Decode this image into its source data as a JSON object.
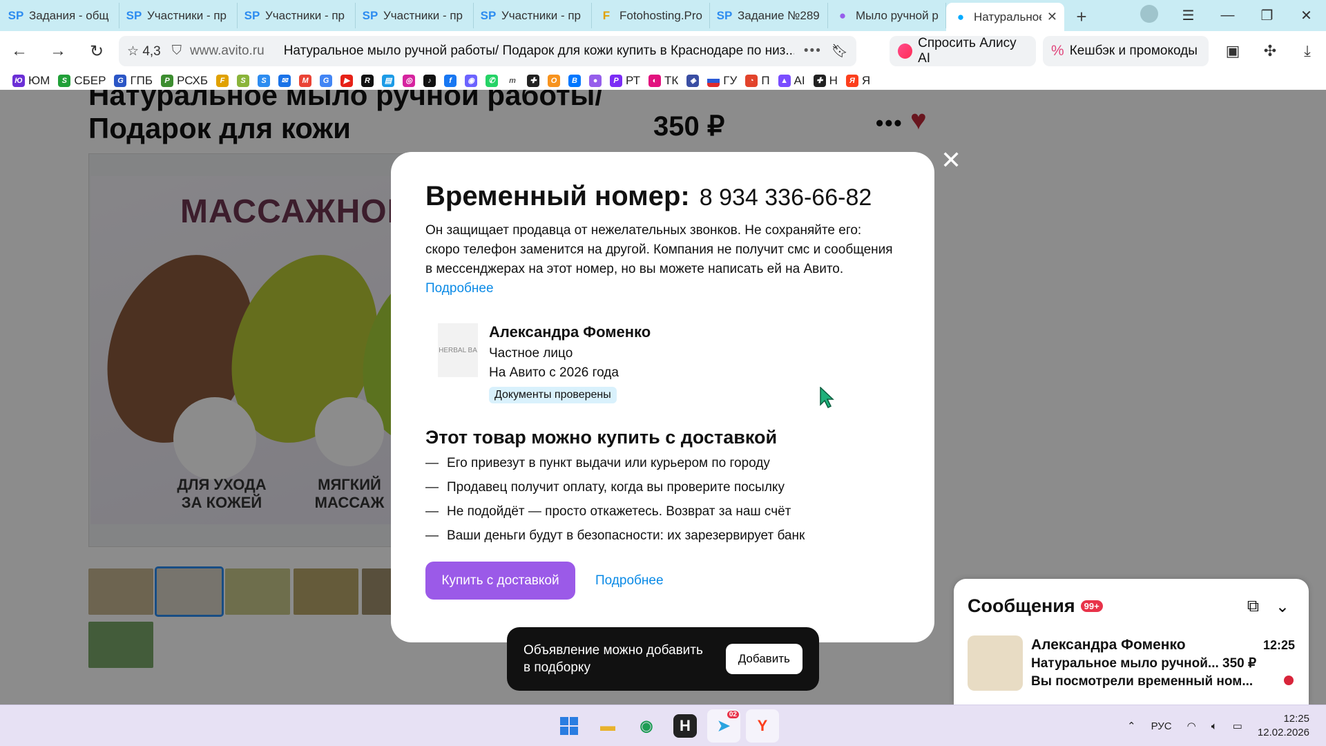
{
  "browser": {
    "tabs": [
      {
        "fav": "SP",
        "title": "Задания - общ"
      },
      {
        "fav": "SP",
        "title": "Участники - пр"
      },
      {
        "fav": "SP",
        "title": "Участники - пр"
      },
      {
        "fav": "SP",
        "title": "Участники - пр"
      },
      {
        "fav": "SP",
        "title": "Участники - пр"
      },
      {
        "fav": "F",
        "title": "Fotohosting.Pro"
      },
      {
        "fav": "SP",
        "title": "Задание №289"
      },
      {
        "fav": "●",
        "title": "Мыло ручной р"
      },
      {
        "fav": "●",
        "title": "Натуральное"
      }
    ],
    "rating": "4,3",
    "domain": "www.avito.ru",
    "page_title": "Натуральное мыло ручной работы/ Подарок для кожи купить в Краснодаре по низ...",
    "alice_label": "Спросить Алису AI",
    "cashback_label": "Кешбэк и промокоды",
    "bookmarks": [
      "ЮМ",
      "СБЕР",
      "ГПБ",
      "РСХБ",
      "",
      "",
      "",
      "",
      "",
      "",
      "",
      "",
      "",
      "",
      "",
      "",
      "",
      "",
      "",
      "",
      "",
      "",
      "",
      "",
      "",
      "РТ",
      "ТК",
      "",
      "ГУ",
      "П",
      "AI",
      "Н",
      "Я"
    ]
  },
  "listing": {
    "title_line2": "Подарок для кожи",
    "title_line1": "Натуральное мыло ручной работы/",
    "price": "350 ₽",
    "photo_text": "МАССАЖНОЕ",
    "caption1": "ДЛЯ УХОДА\nЗА КОЖЕЙ",
    "caption2": "МЯГКИЙ\nМАССАЖ"
  },
  "modal": {
    "heading": "Временный номер:",
    "phone": "8 934 336-66-82",
    "desc": "Он защищает продавца от нежелательных звонков. Не сохраняйте его: скоро телефон заменится на другой. Компания не получит смс и сообщения в мессенджерах на этот номер, но вы можете написать ей на Авито.",
    "desc_link": "Подробнее",
    "seller_name": "Александра Фоменко",
    "seller_type": "Частное лицо",
    "seller_since": "На Авито с 2026 года",
    "seller_badge": "Документы проверены",
    "seller_logo_text": "HERBAL BA",
    "delivery_heading": "Этот товар можно купить с доставкой",
    "delivery_points": [
      "Его привезут в пункт выдачи или курьером по городу",
      "Продавец получит оплату, когда вы проверите посылку",
      "Не подойдёт — просто откажетесь. Возврат за наш счёт",
      "Ваши деньги будут в безопасности: их зарезервирует банк"
    ],
    "buy_button": "Купить с доставкой",
    "more_link": "Подробнее"
  },
  "toast": {
    "text": "Объявление можно добавить в подборку",
    "button": "Добавить"
  },
  "messages": {
    "title": "Сообщения",
    "count": "99+",
    "item": {
      "name": "Александра Фоменко",
      "time": "12:25",
      "line1": "Натуральное мыло ручной... 350 ₽",
      "line2": "Вы посмотрели временный ном..."
    }
  },
  "taskbar": {
    "telegram_badge": "02",
    "lang": "РУС",
    "time": "12:25",
    "date": "12.02.2026"
  }
}
